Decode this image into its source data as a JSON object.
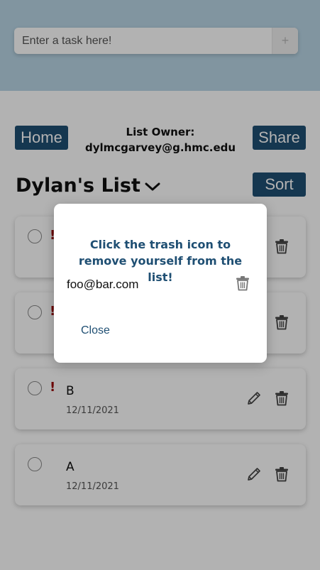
{
  "task_input": {
    "placeholder": "Enter a task here!",
    "add_label": "+"
  },
  "header": {
    "home_label": "Home",
    "share_label": "Share",
    "owner_label": "List Owner:",
    "owner_email": "dylmcgarvey@g.hmc.edu"
  },
  "list": {
    "title": "Dylan's List",
    "sort_label": "Sort"
  },
  "tasks": [
    {
      "name": "",
      "date": "",
      "priority": "!"
    },
    {
      "name": "",
      "date": "",
      "priority": "!"
    },
    {
      "name": "B",
      "date": "12/11/2021",
      "priority": "!"
    },
    {
      "name": "A",
      "date": "12/11/2021",
      "priority": ""
    }
  ],
  "modal": {
    "title": "Click the trash icon to remove yourself from the list!",
    "members": [
      "foo@bar.com"
    ],
    "close_label": "Close"
  },
  "colors": {
    "brand": "#1f4f73",
    "priority": "#9b0a0a",
    "header_bg": "#b9d6e6"
  }
}
